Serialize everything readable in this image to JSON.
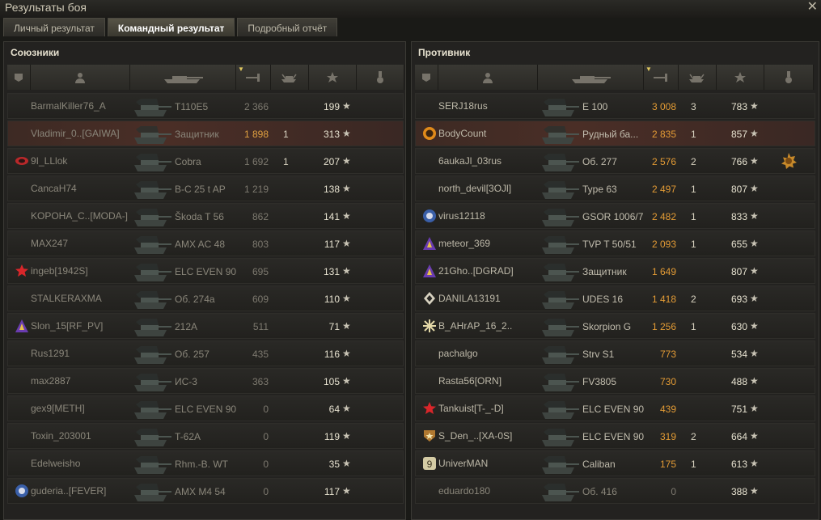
{
  "window": {
    "title": "Результаты боя",
    "close": "✕"
  },
  "tabs": [
    {
      "label": "Личный результат"
    },
    {
      "label": "Командный результат"
    },
    {
      "label": "Подробный отчёт"
    }
  ],
  "allies": {
    "title": "Союзники",
    "rows": [
      {
        "name": "BarmalKiller76_A",
        "vehicle": "T110E5",
        "damage": "2 366",
        "kills": "",
        "xp": "199",
        "badge": ""
      },
      {
        "name": "Vladimir_0..[GAIWA]",
        "vehicle": "Защитник",
        "damage": "1 898",
        "kills": "1",
        "xp": "313",
        "badge": ""
      },
      {
        "name": "9I_LLlok",
        "vehicle": "Cobra",
        "damage": "1 692",
        "kills": "1",
        "xp": "207",
        "badge": "clan-red"
      },
      {
        "name": "CancaH74",
        "vehicle": "B-C 25 t AP",
        "damage": "1 219",
        "kills": "",
        "xp": "138",
        "badge": ""
      },
      {
        "name": "KOPOHA_C..[MODA-]",
        "vehicle": "Škoda T 56",
        "damage": "862",
        "kills": "",
        "xp": "141",
        "badge": ""
      },
      {
        "name": "MAX247",
        "vehicle": "AMX AC 48",
        "damage": "803",
        "kills": "",
        "xp": "117",
        "badge": ""
      },
      {
        "name": "ingeb[1942S]",
        "vehicle": "ELC EVEN 90",
        "damage": "695",
        "kills": "",
        "xp": "131",
        "badge": "clan-star"
      },
      {
        "name": "STALKERAXMA",
        "vehicle": "Об. 274а",
        "damage": "609",
        "kills": "",
        "xp": "110",
        "badge": ""
      },
      {
        "name": "Slon_15[RF_PV]",
        "vehicle": "212A",
        "damage": "511",
        "kills": "",
        "xp": "71",
        "badge": "clan-purple"
      },
      {
        "name": "Rus1291",
        "vehicle": "Об. 257",
        "damage": "435",
        "kills": "",
        "xp": "116",
        "badge": ""
      },
      {
        "name": "max2887",
        "vehicle": "ИС-3",
        "damage": "363",
        "kills": "",
        "xp": "105",
        "badge": ""
      },
      {
        "name": "gex9[METH]",
        "vehicle": "ELC EVEN 90",
        "damage": "0",
        "kills": "",
        "xp": "64",
        "badge": ""
      },
      {
        "name": "Toxin_203001",
        "vehicle": "T-62A",
        "damage": "0",
        "kills": "",
        "xp": "119",
        "badge": ""
      },
      {
        "name": "Edelweisho",
        "vehicle": "Rhm.-B. WT",
        "damage": "0",
        "kills": "",
        "xp": "35",
        "badge": ""
      },
      {
        "name": "guderia..[FEVER]",
        "vehicle": "AMX M4 54",
        "damage": "0",
        "kills": "",
        "xp": "117",
        "badge": "clan-blue"
      }
    ]
  },
  "enemies": {
    "title": "Противник",
    "rows": [
      {
        "name": "SERJ18rus",
        "vehicle": "E 100",
        "damage": "3 008",
        "kills": "3",
        "xp": "783",
        "badge": ""
      },
      {
        "name": "BodyCount",
        "vehicle": "Рудный ба...",
        "damage": "2 835",
        "kills": "1",
        "xp": "857",
        "badge": "clan-orange"
      },
      {
        "name": "6aukaJl_03rus",
        "vehicle": "Об. 277",
        "damage": "2 576",
        "kills": "2",
        "xp": "766",
        "badge": ""
      },
      {
        "name": "north_devil[3OJl]",
        "vehicle": "Type 63",
        "damage": "2 497",
        "kills": "1",
        "xp": "807",
        "badge": ""
      },
      {
        "name": "virus12118",
        "vehicle": "GSOR 1006/7",
        "damage": "2 482",
        "kills": "1",
        "xp": "833",
        "badge": "clan-blue"
      },
      {
        "name": "meteor_369",
        "vehicle": "TVP T 50/51",
        "damage": "2 093",
        "kills": "1",
        "xp": "655",
        "badge": "clan-purple"
      },
      {
        "name": "21Gho..[DGRAD]",
        "vehicle": "Защитник",
        "damage": "1 649",
        "kills": "",
        "xp": "807",
        "badge": "clan-purple"
      },
      {
        "name": "DANILA13191",
        "vehicle": "UDES 16",
        "damage": "1 418",
        "kills": "2",
        "xp": "693",
        "badge": "clan-diamond"
      },
      {
        "name": "B_AHrAP_16_2..",
        "vehicle": "Skorpion G",
        "damage": "1 256",
        "kills": "1",
        "xp": "630",
        "badge": "clan-snow"
      },
      {
        "name": "pachalgo",
        "vehicle": "Strv S1",
        "damage": "773",
        "kills": "",
        "xp": "534",
        "badge": ""
      },
      {
        "name": "Rasta56[ORN]",
        "vehicle": "FV3805",
        "damage": "730",
        "kills": "",
        "xp": "488",
        "badge": ""
      },
      {
        "name": "Tankuist[T-_-D]",
        "vehicle": "ELC EVEN 90",
        "damage": "439",
        "kills": "",
        "xp": "751",
        "badge": "clan-star"
      },
      {
        "name": "S_Den_..[XA-0S]",
        "vehicle": "ELC EVEN 90",
        "damage": "319",
        "kills": "2",
        "xp": "664",
        "badge": "clan-shield"
      },
      {
        "name": "UniverMAN",
        "vehicle": "Caliban",
        "damage": "175",
        "kills": "1",
        "xp": "613",
        "badge": "clan-9"
      },
      {
        "name": "eduardo180",
        "vehicle": "Об. 416",
        "damage": "0",
        "kills": "",
        "xp": "388",
        "badge": ""
      }
    ]
  },
  "star_glyph": "★"
}
